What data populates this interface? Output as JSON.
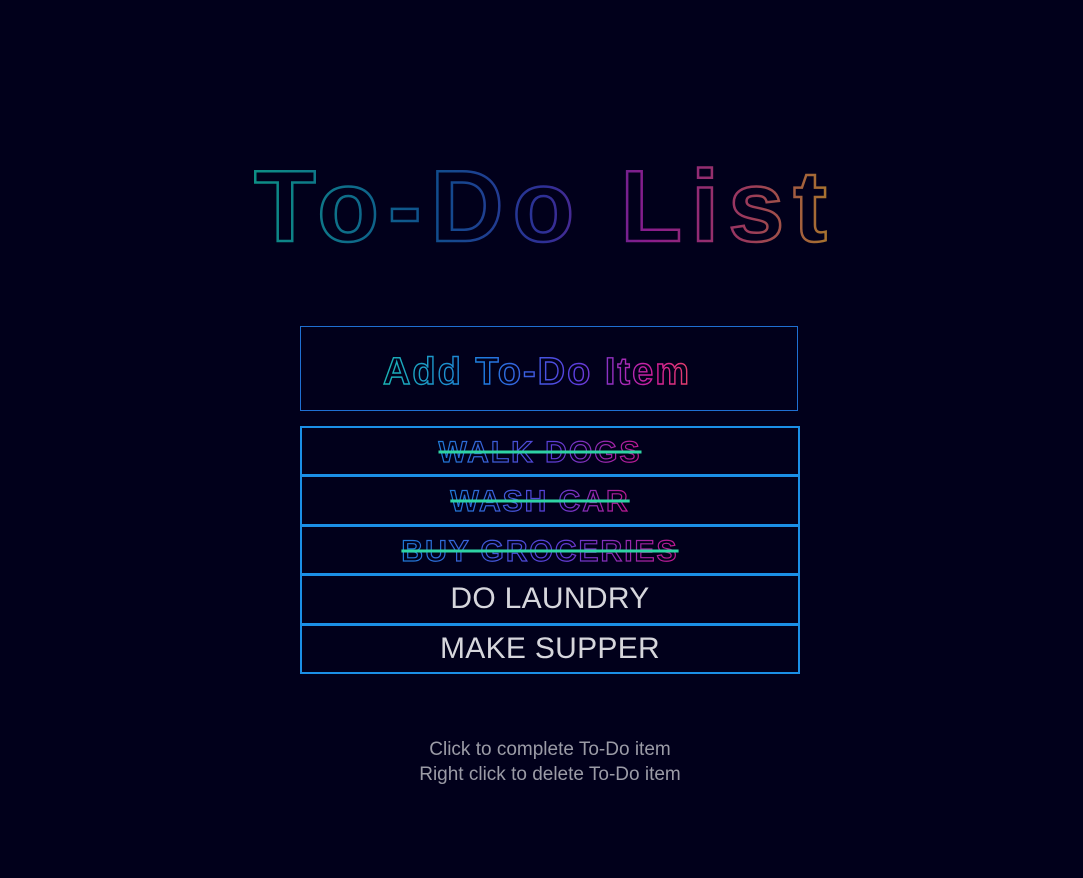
{
  "header": {
    "title": "To-Do List"
  },
  "input": {
    "placeholder": "Add To-Do Item"
  },
  "todos": [
    {
      "text": "WALK DOGS",
      "completed": true
    },
    {
      "text": "WASH CAR",
      "completed": true
    },
    {
      "text": "BUY GROCERIES",
      "completed": true
    },
    {
      "text": "DO LAUNDRY",
      "completed": false
    },
    {
      "text": "MAKE SUPPER",
      "completed": false
    }
  ],
  "instructions": {
    "line1": "Click to complete To-Do item",
    "line2": "Right click to delete To-Do item"
  },
  "colors": {
    "background": "#01001b",
    "border": "#1b8fe6",
    "strike": "#2ed3a4",
    "plain_text": "#d6d6dc",
    "help_text": "#9b9ba6"
  }
}
